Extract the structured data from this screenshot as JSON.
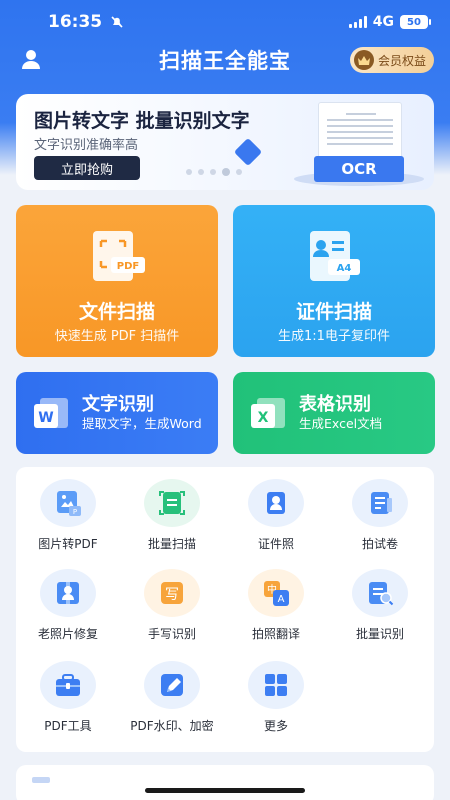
{
  "status": {
    "time": "16:35",
    "network": "4G",
    "battery": "50"
  },
  "header": {
    "title": "扫描王全能宝",
    "vip_label": "会员权益"
  },
  "banner": {
    "title": "图片转文字  批量识别文字",
    "subtitle": "文字识别准确率高",
    "button": "立即抢购",
    "badge": "OCR"
  },
  "cards": {
    "scan": {
      "title": "文件扫描",
      "subtitle": "快速生成 PDF 扫描件",
      "icon_tag": "PDF"
    },
    "id": {
      "title": "证件扫描",
      "subtitle": "生成1:1电子复印件",
      "icon_tag": "A4"
    },
    "ocr": {
      "title": "文字识别",
      "subtitle": "提取文字，生成Word",
      "icon_tag": "W"
    },
    "table": {
      "title": "表格识别",
      "subtitle": "生成Excel文档",
      "icon_tag": "X"
    }
  },
  "tools": [
    {
      "label": "图片转PDF",
      "icon": "image-to-pdf-icon"
    },
    {
      "label": "批量扫描",
      "icon": "batch-scan-icon"
    },
    {
      "label": "证件照",
      "icon": "id-photo-icon"
    },
    {
      "label": "拍试卷",
      "icon": "exam-paper-icon"
    },
    {
      "label": "老照片修复",
      "icon": "photo-restore-icon"
    },
    {
      "label": "手写识别",
      "icon": "handwriting-icon"
    },
    {
      "label": "拍照翻译",
      "icon": "photo-translate-icon"
    },
    {
      "label": "批量识别",
      "icon": "batch-recognize-icon"
    },
    {
      "label": "PDF工具",
      "icon": "toolbox-icon"
    },
    {
      "label": "PDF水印、加密",
      "icon": "watermark-icon"
    },
    {
      "label": "更多",
      "icon": "more-grid-icon"
    }
  ],
  "tool_glyphs": {
    "handwriting": "写",
    "translate_cn": "中",
    "translate_en": "A"
  },
  "colors": {
    "primary": "#2f74ef",
    "orange": "#f89726",
    "sky": "#2ba3ef",
    "green": "#21c179"
  }
}
